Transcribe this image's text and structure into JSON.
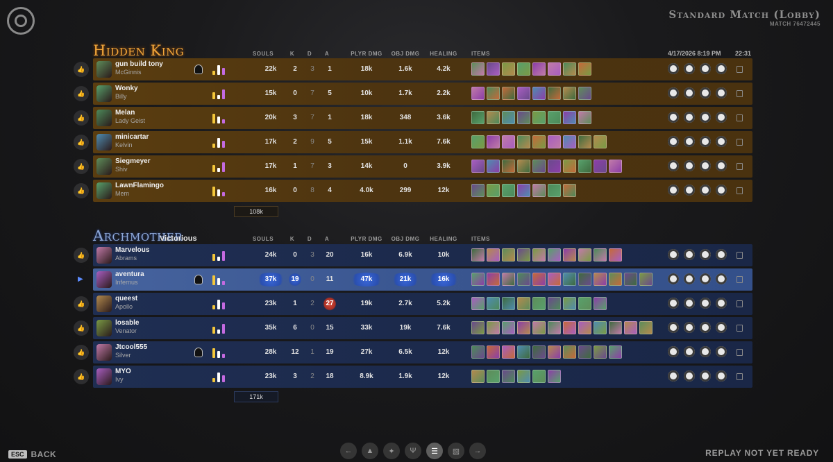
{
  "header": {
    "match_title": "Standard Match (Lobby)",
    "match_id": "MATCH 76472445",
    "date": "4/17/2026 8:19 PM",
    "duration": "22:31"
  },
  "columns": [
    "SOULS",
    "K",
    "D",
    "A",
    "PLYR DMG",
    "OBJ DMG",
    "HEALING",
    "ITEMS"
  ],
  "teams": [
    {
      "name": "Hidden King",
      "status": "",
      "total_souls": "108k",
      "accent": "#f2a63b",
      "players": [
        {
          "player": "gun build tony",
          "hero": "McGinnis",
          "souls": "22k",
          "k": "2",
          "d": "3",
          "a": "1",
          "plyr_dmg": "18k",
          "obj_dmg": "1.6k",
          "healing": "4.2k",
          "item_count": 8,
          "rank_badge": true
        },
        {
          "player": "Wonky",
          "hero": "Billy",
          "souls": "15k",
          "k": "0",
          "d": "7",
          "a": "5",
          "plyr_dmg": "10k",
          "obj_dmg": "1.7k",
          "healing": "2.2k",
          "item_count": 8
        },
        {
          "player": "Melan",
          "hero": "Lady Geist",
          "souls": "20k",
          "k": "3",
          "d": "7",
          "a": "1",
          "plyr_dmg": "18k",
          "obj_dmg": "348",
          "healing": "3.6k",
          "item_count": 8
        },
        {
          "player": "minicartar",
          "hero": "Kelvin",
          "souls": "17k",
          "k": "2",
          "d": "9",
          "a": "5",
          "plyr_dmg": "15k",
          "obj_dmg": "1.1k",
          "healing": "7.6k",
          "item_count": 9
        },
        {
          "player": "Siegmeyer",
          "hero": "Shiv",
          "souls": "17k",
          "k": "1",
          "d": "7",
          "a": "3",
          "plyr_dmg": "14k",
          "obj_dmg": "0",
          "healing": "3.9k",
          "item_count": 10
        },
        {
          "player": "LawnFlamingo",
          "hero": "Mem",
          "souls": "16k",
          "k": "0",
          "d": "8",
          "a": "4",
          "plyr_dmg": "4.0k",
          "obj_dmg": "299",
          "healing": "12k",
          "item_count": 7
        }
      ]
    },
    {
      "name": "Archmother",
      "status": "Victorious",
      "total_souls": "171k",
      "accent": "#8ea8d8",
      "players": [
        {
          "player": "Marvelous",
          "hero": "Abrams",
          "souls": "24k",
          "k": "0",
          "d": "3",
          "a": "20",
          "plyr_dmg": "16k",
          "obj_dmg": "6.9k",
          "healing": "10k",
          "item_count": 10
        },
        {
          "player": "aventura",
          "hero": "Infernus",
          "souls": "37k",
          "k": "19",
          "d": "0",
          "a": "11",
          "plyr_dmg": "47k",
          "obj_dmg": "21k",
          "healing": "16k",
          "item_count": 12,
          "highlight": true,
          "rank_badge": true
        },
        {
          "player": "queest",
          "hero": "Apollo",
          "souls": "23k",
          "k": "1",
          "d": "2",
          "a": "27",
          "plyr_dmg": "19k",
          "obj_dmg": "2.7k",
          "healing": "5.2k",
          "item_count": 9
        },
        {
          "player": "losable",
          "hero": "Venator",
          "souls": "35k",
          "k": "6",
          "d": "0",
          "a": "15",
          "plyr_dmg": "33k",
          "obj_dmg": "19k",
          "healing": "7.6k",
          "item_count": 12
        },
        {
          "player": "Jtcool555",
          "hero": "Silver",
          "souls": "28k",
          "k": "12",
          "d": "1",
          "a": "19",
          "plyr_dmg": "27k",
          "obj_dmg": "6.5k",
          "healing": "12k",
          "item_count": 10,
          "rank_badge": true
        },
        {
          "player": "MYO",
          "hero": "Ivy",
          "souls": "23k",
          "k": "3",
          "d": "2",
          "a": "18",
          "plyr_dmg": "8.9k",
          "obj_dmg": "1.9k",
          "healing": "12k",
          "item_count": 6
        }
      ]
    }
  ],
  "footer": {
    "esc_key": "ESC",
    "back_label": "BACK",
    "replay_status": "REPLAY NOT YET READY",
    "nav_icons": [
      "arrow-left-icon",
      "trophy-icon",
      "trinket-icon",
      "flame-icon",
      "list-icon",
      "chart-icon",
      "arrow-right-icon"
    ]
  }
}
